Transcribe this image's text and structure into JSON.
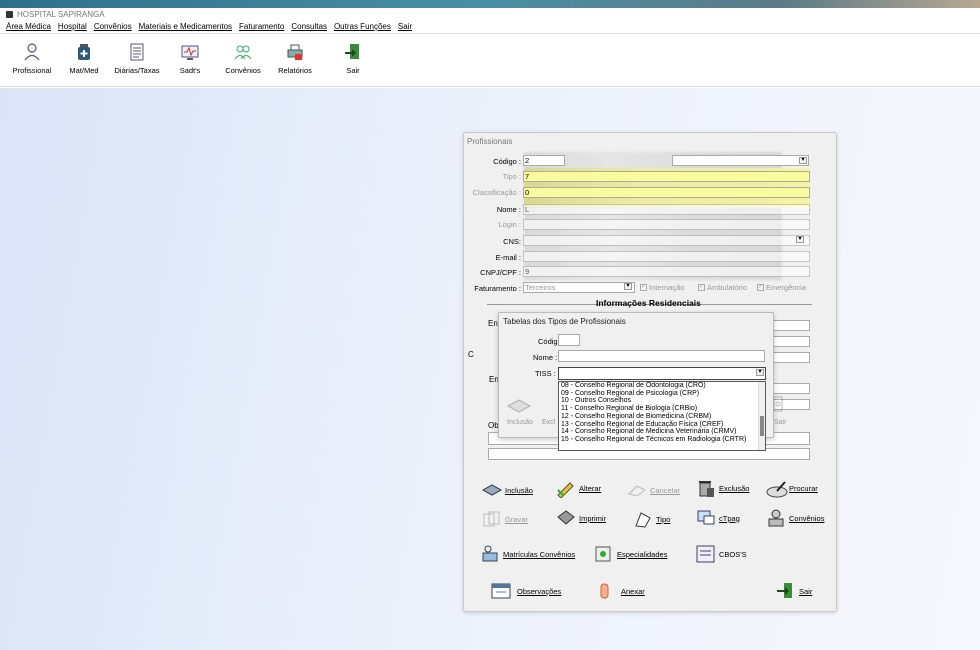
{
  "window": {
    "title": "HOSPITAL SAPIRANGA"
  },
  "menu": [
    "Área Médica",
    "Hospital",
    "Convênios",
    "Materiais e Medicamentos",
    "Faturamento",
    "Consultas",
    "Outras Funções",
    "Sair"
  ],
  "toolbar": [
    {
      "label": "Profissional",
      "icon": "doctor-icon"
    },
    {
      "label": "Mat/Med",
      "icon": "medicine-icon"
    },
    {
      "label": "Diárias/Taxas",
      "icon": "document-icon"
    },
    {
      "label": "Sadt's",
      "icon": "monitor-icon"
    },
    {
      "label": "Convênios",
      "icon": "group-icon"
    },
    {
      "label": "Relatórios",
      "icon": "printer-icon"
    },
    {
      "label": "Sair",
      "icon": "exit-icon"
    }
  ],
  "profissionais": {
    "title": "Profissionais",
    "fields": {
      "codigo": {
        "label": "Código :",
        "value": "2"
      },
      "tipo": {
        "label": "Tipo :",
        "value": "7"
      },
      "classificacao": {
        "label": "Classificação :",
        "value": "0"
      },
      "nome": {
        "label": "Nome :",
        "value": "L"
      },
      "login": {
        "label": "Login :",
        "value": ""
      },
      "cns": {
        "label": "CNS:",
        "value": ""
      },
      "email": {
        "label": "E-mail :",
        "value": ""
      },
      "cnpj": {
        "label": "CNPJ/CPF :",
        "value": "9"
      },
      "faturamento": {
        "label": "Faturamento :",
        "value": "Terceiros"
      }
    },
    "checks": {
      "internacao": "Internação",
      "ambulatorio": "Ambulatório",
      "emergencia": "Emergência"
    },
    "section_title": "Informações Residenciais",
    "partial_labels": {
      "en1": "End",
      "en2": "En",
      "c": "C",
      "ob": "Obs"
    },
    "buttons": {
      "inclusao": "Inclusão",
      "alterar": "Alterar",
      "cancelar": "Cancelar",
      "exclusao": "Exclusão",
      "procurar": "Procurar",
      "gravar": "Gravar",
      "imprimir": "Imprimir",
      "tipo": "Tipo",
      "ctpag": "cTpag",
      "convenios": "Convênios",
      "matriculas": "Matrículas Convênios",
      "especialidades": "Especialidades",
      "cbos": "CBOS'S",
      "observacoes": "Observações",
      "anexar": "Anexar",
      "sair": "Sair"
    }
  },
  "tipos": {
    "title": "Tabelas dos Tipos de Profissionais",
    "codigo_label": "Código :",
    "nome_label": "Nome :",
    "tiss_label": "TISS :",
    "list": [
      "08 - Conselho Regional de Odontologia (CRO)",
      "09 - Conselho Regional de Psicologia (CRP)",
      "10 - Outros Conselhos",
      "11 - Conselho Regional de Biologia (CRBio)",
      "12 - Conselho Regional de Biomedicina (CRBM)",
      "13 - Conselho Regional de Educação Física (CREF)",
      "14 - Conselho Regional de Medicina Veterinária (CRMV)",
      "15 - Conselho Regional de Técnicos em Radiologia (CRTR)"
    ],
    "inclusao": "Inclusão",
    "exclusao_partial": "Excl",
    "sair": "Sair"
  }
}
